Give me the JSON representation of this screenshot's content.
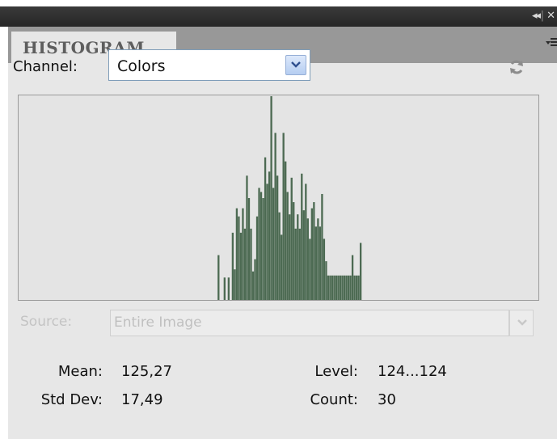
{
  "window": {
    "collapse_glyph": "◂◂",
    "separator": "|",
    "close_glyph": "✕"
  },
  "panel": {
    "title": "HISTOGRAM",
    "menu_icon": "panel-menu-icon"
  },
  "channel": {
    "label": "Channel:",
    "value": "Colors"
  },
  "source": {
    "label": "Source:",
    "value": "Entire Image",
    "disabled": true
  },
  "stats": {
    "mean_label": "Mean:",
    "mean_value": "125,27",
    "stddev_label": "Std Dev:",
    "stddev_value": "17,49",
    "level_label": "Level:",
    "level_value": "124...124",
    "count_label": "Count:",
    "count_value": "30"
  },
  "colors": {
    "histogram_bars": "#4c6a52",
    "panel_bg": "#e7e7e7",
    "tab_strip": "#989898"
  },
  "chart_data": {
    "type": "bar",
    "xlim": [
      0,
      255
    ],
    "ylim": [
      0,
      1
    ],
    "x": [
      98,
      101,
      103,
      105,
      106,
      107,
      108,
      109,
      110,
      111,
      112,
      113,
      114,
      115,
      116,
      117,
      118,
      119,
      120,
      121,
      122,
      123,
      124,
      125,
      126,
      127,
      128,
      129,
      130,
      131,
      132,
      133,
      134,
      135,
      136,
      137,
      138,
      139,
      140,
      141,
      142,
      143,
      144,
      145,
      146,
      147,
      148,
      149,
      150,
      151,
      152,
      153,
      154,
      155,
      156,
      157,
      158,
      159,
      160,
      161,
      162,
      163,
      164,
      165,
      166,
      167,
      168
    ],
    "values": [
      0.22,
      0.11,
      0.11,
      0.33,
      0.15,
      0.45,
      0.41,
      0.33,
      0.45,
      0.35,
      0.61,
      0.5,
      0.35,
      0.14,
      0.2,
      0.41,
      0.55,
      0.53,
      0.5,
      0.7,
      0.57,
      0.63,
      1.0,
      0.55,
      0.82,
      0.61,
      0.43,
      0.32,
      0.82,
      0.68,
      0.53,
      0.42,
      0.6,
      0.48,
      0.35,
      0.42,
      0.35,
      0.62,
      0.44,
      0.57,
      0.4,
      0.3,
      0.45,
      0.48,
      0.36,
      0.4,
      0.36,
      0.52,
      0.3,
      0.19,
      0.12,
      0.12,
      0.12,
      0.12,
      0.12,
      0.12,
      0.12,
      0.12,
      0.12,
      0.12,
      0.12,
      0.12,
      0.22,
      0.12,
      0.12,
      0.12,
      0.28
    ]
  }
}
